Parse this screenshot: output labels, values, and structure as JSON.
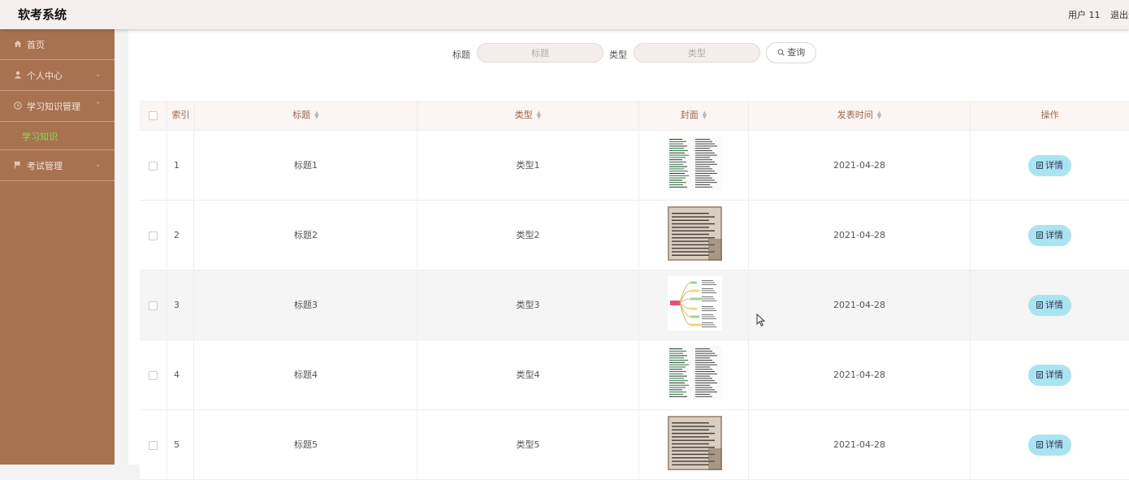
{
  "header": {
    "app_title": "软考系统",
    "user": "用户 11",
    "logout": "退出登录"
  },
  "sidebar": {
    "items": [
      {
        "label": "首页",
        "icon": "home-icon"
      },
      {
        "label": "个人中心",
        "icon": "user-icon"
      },
      {
        "label": "学习知识管理",
        "icon": "clock-icon"
      },
      {
        "label": "考试管理",
        "icon": "flag-icon"
      }
    ],
    "sub_active": "学习知识"
  },
  "search": {
    "title_label": "标题",
    "title_placeholder": "标题",
    "type_label": "类型",
    "type_placeholder": "类型",
    "button": "查询"
  },
  "table": {
    "columns": [
      "索引",
      "标题",
      "类型",
      "封面",
      "发表时间",
      "操作"
    ],
    "rows": [
      {
        "index": "1",
        "title": "标题1",
        "type": "类型1",
        "cover": "text-page",
        "date": "2021-04-28",
        "action": "详情"
      },
      {
        "index": "2",
        "title": "标题2",
        "type": "类型2",
        "cover": "book-photo",
        "date": "2021-04-28",
        "action": "详情"
      },
      {
        "index": "3",
        "title": "标题3",
        "type": "类型3",
        "cover": "mindmap",
        "date": "2021-04-28",
        "action": "详情"
      },
      {
        "index": "4",
        "title": "标题4",
        "type": "类型4",
        "cover": "text-page",
        "date": "2021-04-28",
        "action": "详情"
      },
      {
        "index": "5",
        "title": "标题5",
        "type": "类型5",
        "cover": "book-photo",
        "date": "2021-04-28",
        "action": "详情"
      }
    ]
  },
  "colors": {
    "sidebar": "#a87251",
    "active_sub": "#83e04a",
    "detail_button": "#a9e4f1",
    "header_bg": "#f5f0ef"
  }
}
